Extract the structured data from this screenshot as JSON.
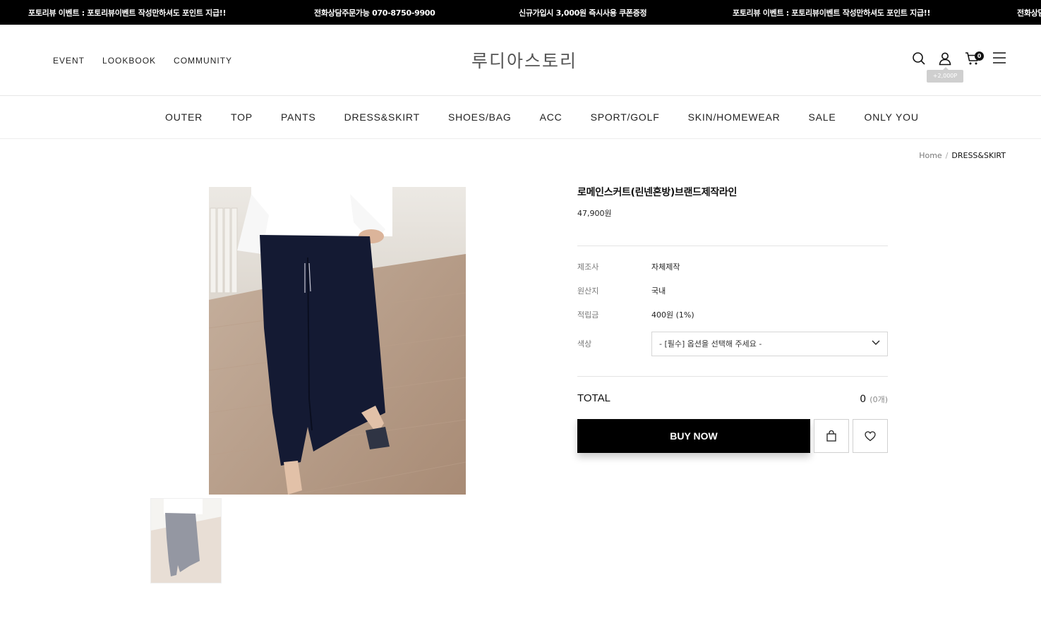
{
  "announcement": {
    "items": [
      "포토리뷰 이벤트 : 포토리뷰이벤트 작성만하셔도 포인트 지급!!",
      "전화상담주문가능 070-8750-9900",
      "신규가입시 3,000원 즉시사용 쿠폰증정",
      "포토리뷰 이벤트 : 포토리뷰이벤트 작성만하셔도 포인트 지급!!",
      "전화상담"
    ]
  },
  "header": {
    "links": [
      "EVENT",
      "LOOKBOOK",
      "COMMUNITY"
    ],
    "logo": "루디아스토리",
    "cart_count": "0",
    "point_badge": "+2,000P"
  },
  "nav": {
    "categories": [
      "OUTER",
      "TOP",
      "PANTS",
      "DRESS&SKIRT",
      "SHOES/BAG",
      "ACC",
      "SPORT/GOLF",
      "SKIN/HOMEWEAR",
      "SALE",
      "ONLY YOU"
    ]
  },
  "breadcrumb": {
    "home": "Home",
    "separator": "/",
    "current": "DRESS&SKIRT"
  },
  "product": {
    "name": "로메인스커트(린넨혼방)브랜드제작라인",
    "price": "47,900원",
    "specs": [
      {
        "label": "제조사",
        "value": "자체제작"
      },
      {
        "label": "원산지",
        "value": "국내"
      },
      {
        "label": "적립금",
        "value": "400원 (1%)"
      }
    ],
    "option": {
      "label": "색상",
      "selected": "- [필수] 옵션을 선택해 주세요 -"
    },
    "total": {
      "label": "TOTAL",
      "amount": "0",
      "count": "(0개)"
    },
    "buy_label": "BUY NOW"
  },
  "colors": {
    "topbar": "#000000",
    "buy_button": "#000000",
    "skirt": "#141a33"
  },
  "icons": [
    "search-icon",
    "user-icon",
    "cart-icon",
    "menu-icon",
    "chevron-down-icon",
    "shopping-bag-icon",
    "heart-icon"
  ]
}
